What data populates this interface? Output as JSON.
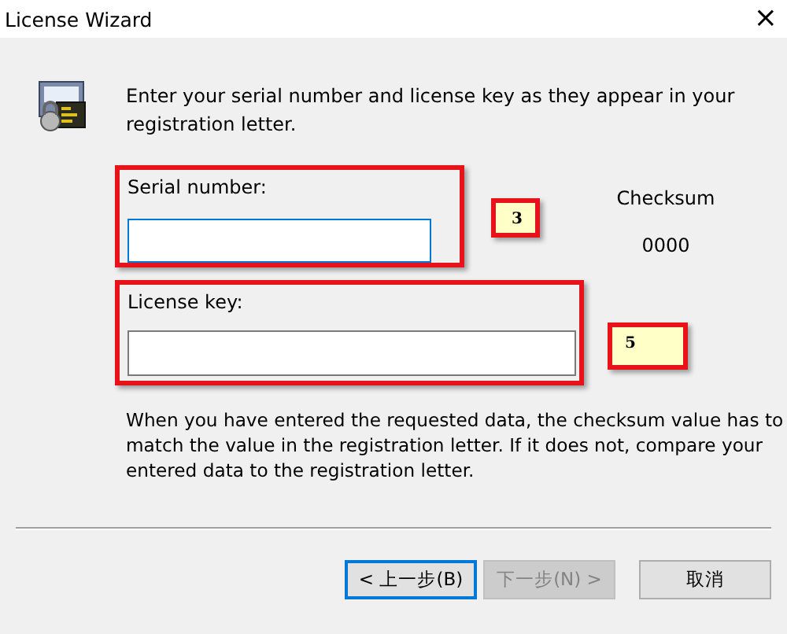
{
  "window": {
    "title": "License Wizard",
    "close": "×"
  },
  "intro": "Enter your serial number and license key as they appear in your registration letter.",
  "fields": [
    {
      "label": "Serial number:",
      "focused": true,
      "annotation": "3"
    },
    {
      "label": "License key:",
      "focused": false,
      "annotation": "5"
    }
  ],
  "checksum": {
    "label": "Checksum",
    "value": "0000"
  },
  "note": "When you have entered the requested data, the checksum value has to match the value in the registration letter.  If it does not, compare your entered data to the registration letter.",
  "buttons": [
    {
      "label": "< 上一步(B)",
      "disabled": false,
      "focused": true
    },
    {
      "label": "下一步(N) >",
      "disabled": true,
      "focused": false
    },
    {
      "label": "取消",
      "disabled": false,
      "focused": false
    }
  ]
}
